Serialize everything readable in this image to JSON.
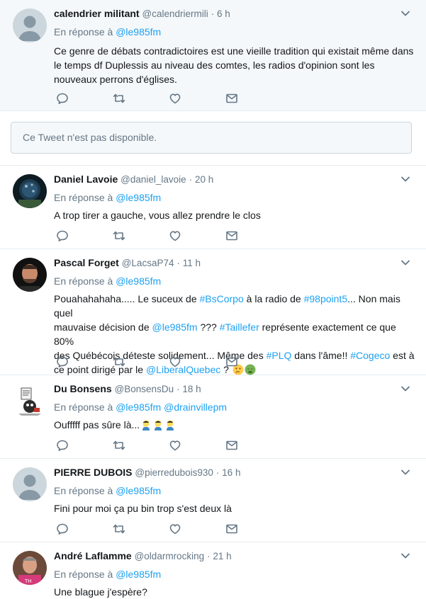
{
  "tweets": [
    {
      "name": "calendrier militant",
      "handle": "@calendriermili",
      "dot": "·",
      "time": "6 h",
      "reply_prefix": "En réponse à",
      "reply_mentions": [
        "@le985fm"
      ],
      "text_lines": [
        "Ce genre de débats contradictoires est une vieille tradition qui existait même dans",
        "le temps df Duplessis au niveau des comtes, les radios d'opinion sont les",
        "nouveaux perrons d'églises."
      ]
    },
    {
      "name": "Daniel Lavoie",
      "handle": "@daniel_lavoie",
      "dot": "·",
      "time": "20 h",
      "reply_prefix": "En réponse à",
      "reply_mentions": [
        "@le985fm"
      ],
      "text": "A trop tirer a gauche, vous allez prendre le clos"
    },
    {
      "name": "Pascal Forget",
      "handle": "@LacsaP74",
      "dot": "·",
      "time": "11 h",
      "reply_prefix": "En réponse à",
      "reply_mentions": [
        "@le985fm"
      ],
      "text_parts": {
        "p1": "Pouahahahaha..... Le suceux de ",
        "l1": "#BsCorpo",
        "p2": " à la radio de ",
        "l2": "#98point5",
        "p3": "... Non mais quel",
        "p4": "mauvaise décision de ",
        "l3": "@le985fm",
        "p5": " ??? ",
        "l4": "#Taillefer",
        "p6": " représente exactement ce que 80%",
        "p7": "des Québécois déteste solidement... Même des ",
        "l5": "#PLQ",
        "p8": " dans l'âme!! ",
        "l6": "#Cogeco",
        "p9": " est à",
        "p10": "ce point dirigé par le ",
        "l7": "@LiberalQuebec",
        "p11": " ? "
      }
    },
    {
      "name": "Du Bonsens",
      "handle": "@BonsensDu",
      "dot": "·",
      "time": "18 h",
      "reply_prefix": "En réponse à",
      "reply_mentions": [
        "@le985fm",
        "@drainvillepm"
      ],
      "text": "Oufffff pas sûre là..."
    },
    {
      "name": "PIERRE DUBOIS",
      "handle": "@pierredubois930",
      "dot": "·",
      "time": "16 h",
      "reply_prefix": "En réponse à",
      "reply_mentions": [
        "@le985fm"
      ],
      "text": "Fini pour moi ça pu bin trop s'est deux là"
    },
    {
      "name": "André Laflamme",
      "handle": "@oldarmrocking",
      "dot": "·",
      "time": "21 h",
      "reply_prefix": "En réponse à",
      "reply_mentions": [
        "@le985fm"
      ],
      "text": "Une blague j'espère?"
    }
  ],
  "unavailable": "Ce Tweet n'est pas disponible.",
  "icons": {
    "reply": "reply-icon",
    "retweet": "retweet-icon",
    "like": "heart-icon",
    "dm": "envelope-icon",
    "caret": "chevron-down-icon"
  },
  "colors": {
    "link": "#1da1f2",
    "muted": "#657786",
    "icon": "#657786"
  }
}
